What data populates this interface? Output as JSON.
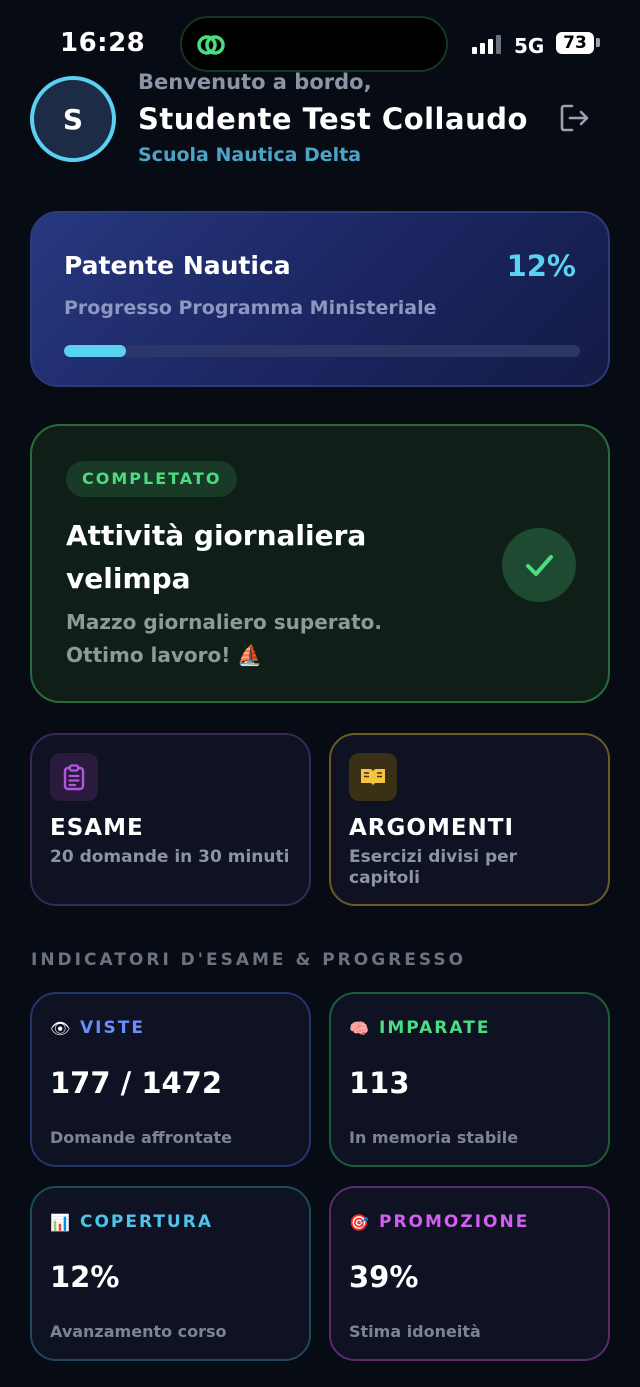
{
  "status_bar": {
    "time": "16:28",
    "network": "5G",
    "battery": "73"
  },
  "header": {
    "avatar_letter": "S",
    "welcome": "Benvenuto a bordo,",
    "name": "Studente Test Collaudo",
    "school": "Scuola Nautica Delta"
  },
  "progress_card": {
    "title": "Patente Nautica",
    "percent_label": "12%",
    "subtitle": "Progresso Programma Ministeriale",
    "progress": 0.12
  },
  "daily_card": {
    "badge": "COMPLETATO",
    "title": "Attività giornaliera velimpa",
    "message": "Mazzo giornaliero superato. Ottimo lavoro! ⛵"
  },
  "actions": {
    "exam": {
      "title": "ESAME",
      "desc": "20 domande in 30 minuti"
    },
    "topics": {
      "title": "ARGOMENTI",
      "desc": "Esercizi divisi per capitoli"
    }
  },
  "section_title": "INDICATORI D'ESAME & PROGRESSO",
  "stats": {
    "viste": {
      "icon": "👁",
      "label": "VISTE",
      "value": "177 / 1472",
      "desc": "Domande affrontate",
      "color": "#6b8cff"
    },
    "imparate": {
      "icon": "🧠",
      "label": "IMPARATE",
      "value": "113",
      "desc": "In memoria stabile",
      "color": "#4ade80"
    },
    "copertura": {
      "icon": "📊",
      "label": "COPERTURA",
      "value": "12%",
      "desc": "Avanzamento corso",
      "color": "#4fc3e8"
    },
    "promozione": {
      "icon": "🎯",
      "label": "PROMOZIONE",
      "value": "39%",
      "desc": "Stima idoneità",
      "color": "#d35ef0"
    }
  },
  "colors": {
    "accent_cyan": "#5ad3f3",
    "success_green": "#4ade80",
    "background": "#070b14"
  }
}
